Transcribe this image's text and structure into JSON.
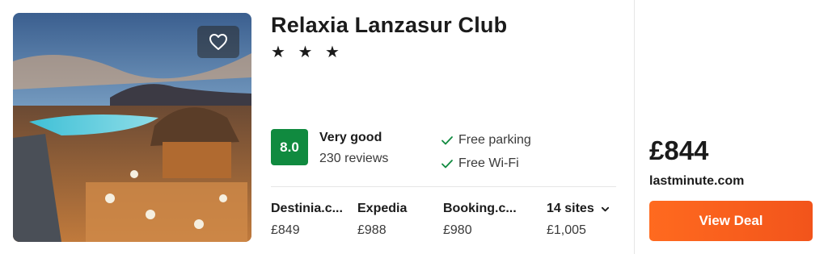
{
  "hotel": {
    "name": "Relaxia Lanzasur Club",
    "stars": "★ ★ ★"
  },
  "rating": {
    "score": "8.0",
    "label": "Very good",
    "reviews": "230 reviews",
    "score_color": "#108a3f"
  },
  "amenities": [
    {
      "label": "Free parking",
      "icon": "check-icon"
    },
    {
      "label": "Free Wi-Fi",
      "icon": "check-icon"
    }
  ],
  "sites": [
    {
      "name": "Destinia.c...",
      "price": "£849"
    },
    {
      "name": "Expedia",
      "price": "£988"
    },
    {
      "name": "Booking.c...",
      "price": "£980"
    },
    {
      "name": "14 sites",
      "price": "£1,005",
      "icon": "chevron-down-icon"
    }
  ],
  "deal": {
    "price": "£844",
    "provider": "lastminute.com",
    "button_label": "View Deal",
    "button_color": "#f2541b"
  },
  "favorite": {
    "icon": "heart-icon"
  }
}
